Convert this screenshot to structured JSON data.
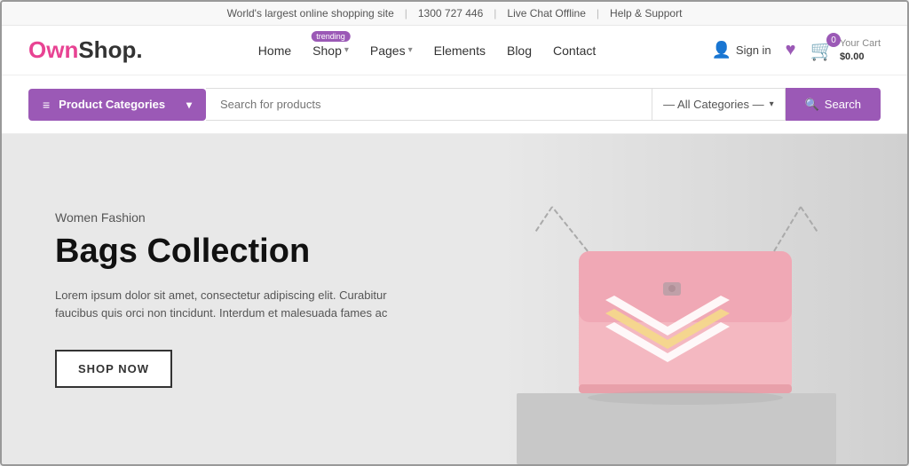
{
  "infobar": {
    "items": [
      {
        "text": "World's largest online shopping site",
        "id": "tagline"
      },
      {
        "text": "1300 727 446",
        "id": "phone"
      },
      {
        "text": "Live Chat Offline",
        "id": "chat"
      },
      {
        "text": "Help & Support",
        "id": "help"
      }
    ]
  },
  "logo": {
    "own": "Own",
    "shop": "Shop",
    "dot": "."
  },
  "nav": {
    "items": [
      {
        "label": "Home",
        "id": "home",
        "hasDropdown": false
      },
      {
        "label": "Shop",
        "id": "shop",
        "hasDropdown": true,
        "badge": "trending"
      },
      {
        "label": "Pages",
        "id": "pages",
        "hasDropdown": true
      },
      {
        "label": "Elements",
        "id": "elements",
        "hasDropdown": false
      },
      {
        "label": "Blog",
        "id": "blog",
        "hasDropdown": false
      },
      {
        "label": "Contact",
        "id": "contact",
        "hasDropdown": false
      }
    ]
  },
  "header_actions": {
    "sign_in": "Sign in",
    "cart_label": "Your Cart",
    "cart_price": "$0.00",
    "cart_count": "0"
  },
  "search": {
    "placeholder": "Search for products",
    "category_default": "— All Categories —",
    "button_label": "Search",
    "categories_btn_label": "Product Categories"
  },
  "hero": {
    "subtitle": "Women Fashion",
    "title": "Bags Collection",
    "description": "Lorem ipsum dolor sit amet, consectetur adipiscing elit. Curabitur faucibus quis orci non tincidunt. Interdum et malesuada fames ac",
    "cta_label": "SHOP NOW"
  },
  "colors": {
    "purple": "#9b59b6",
    "pink": "#e84393",
    "white": "#ffffff"
  }
}
